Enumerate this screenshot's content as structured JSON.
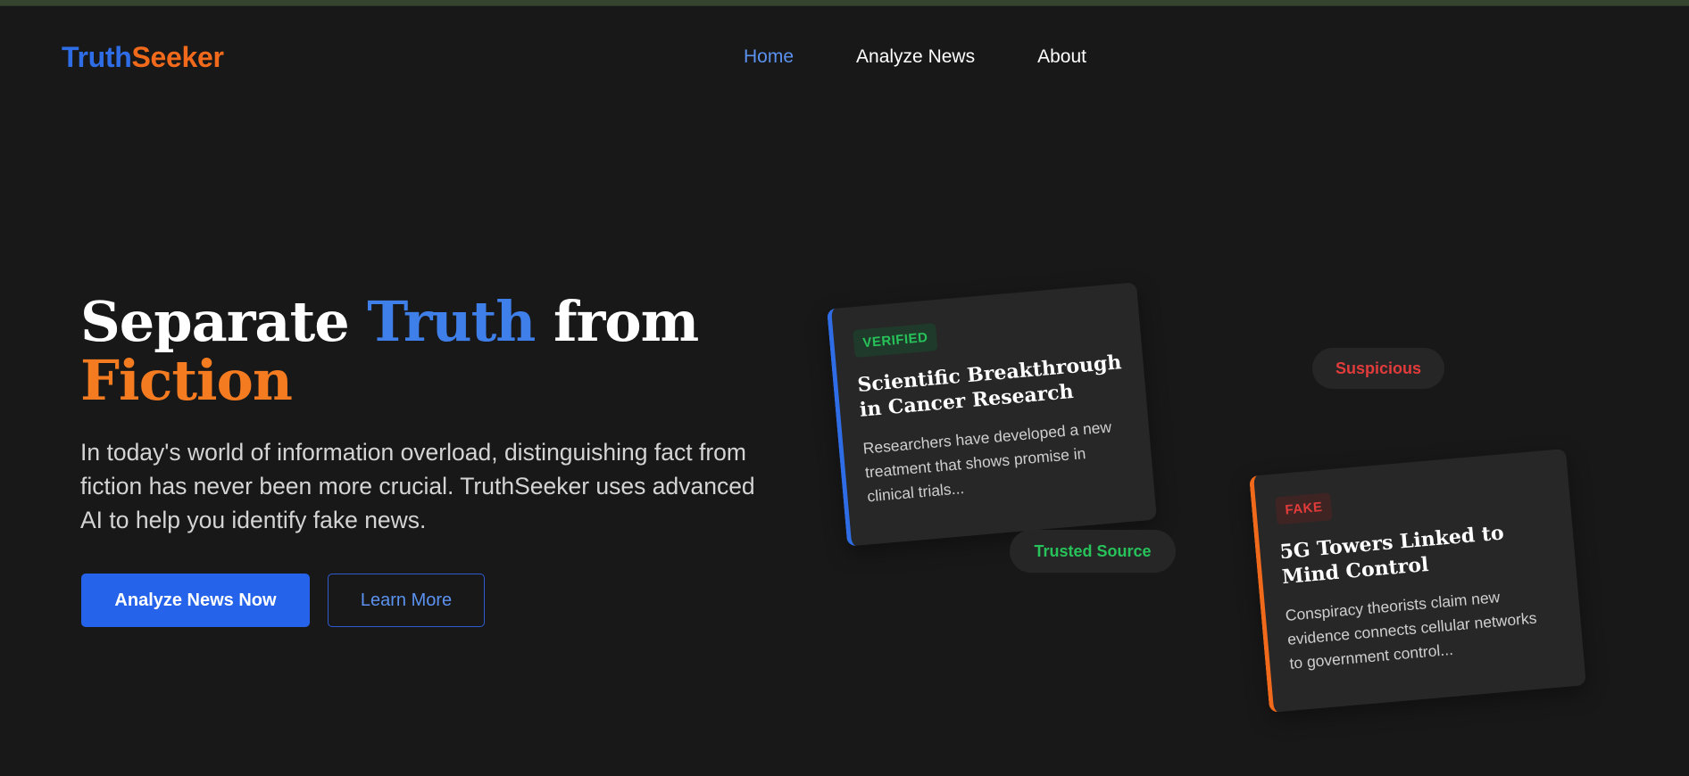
{
  "window": {
    "top_strip_color": "#35442f"
  },
  "header": {
    "logo_part1": "Truth",
    "logo_part2": "Seeker",
    "nav": [
      {
        "label": "Home",
        "active": true
      },
      {
        "label": "Analyze News",
        "active": false
      },
      {
        "label": "About",
        "active": false
      }
    ]
  },
  "hero": {
    "title_part1": "Separate ",
    "title_highlight1": "Truth",
    "title_part2": " from",
    "title_highlight2": "Fiction",
    "description": "In today's world of information overload, distinguishing fact from fiction has never been more crucial. TruthSeeker uses advanced AI to help you identify fake news.",
    "primary_button": "Analyze News Now",
    "secondary_button": "Learn More"
  },
  "cards": [
    {
      "badge": "VERIFIED",
      "title": "Scientific Breakthrough in Cancer Research",
      "text": "Researchers have developed a new treatment that shows promise in clinical trials...",
      "accent_color": "#2f6de6"
    },
    {
      "badge": "FAKE",
      "title": "5G Towers Linked to Mind Control",
      "text": "Conspiracy theorists claim new evidence connects cellular networks to government control...",
      "accent_color": "#f16a1c"
    }
  ],
  "pills": {
    "suspicious": "Suspicious",
    "trusted": "Trusted Source"
  },
  "colors": {
    "background": "#181818",
    "brand_blue": "#2563eb",
    "brand_orange": "#f16a1c",
    "verified_green": "#27c35a",
    "fake_red": "#e23b3b"
  }
}
